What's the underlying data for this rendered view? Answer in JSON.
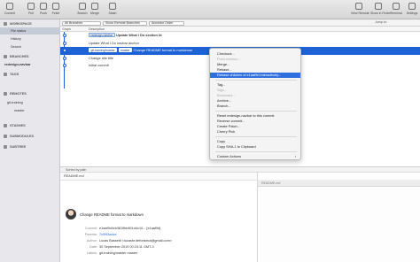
{
  "toolbar": {
    "buttons": [
      {
        "label": "Commit",
        "icon": "commit-icon"
      },
      {
        "label": "Pull",
        "icon": "pull-icon"
      },
      {
        "label": "Push",
        "icon": "push-icon"
      },
      {
        "label": "Fetch",
        "icon": "fetch-icon"
      },
      {
        "label": "Branch",
        "icon": "branch-icon"
      },
      {
        "label": "Merge",
        "icon": "merge-icon"
      },
      {
        "label": "Stash",
        "icon": "stash-icon"
      },
      {
        "label": "View Remote",
        "icon": "remote-icon"
      },
      {
        "label": "Show in Finder",
        "icon": "finder-icon"
      },
      {
        "label": "Terminal",
        "icon": "terminal-icon"
      },
      {
        "label": "Settings",
        "icon": "gear-icon"
      }
    ]
  },
  "sidebar": {
    "workspace": {
      "header": "WORKSPACE",
      "items": [
        "File status",
        "History",
        "Search"
      ]
    },
    "branches": {
      "header": "BRANCHES",
      "items": [
        "redesign-navbar"
      ]
    },
    "tags": {
      "header": "TAGS"
    },
    "remotes": {
      "header": "REMOTES",
      "items": [
        "git-training",
        "master"
      ]
    },
    "stashes": {
      "header": "STASHES"
    },
    "submodules": {
      "header": "SUBMODULES"
    },
    "subtree": {
      "header": "SUBTREE"
    }
  },
  "filters": {
    "branches": "All Branches",
    "remote": "Show Remote Branches",
    "order": "Ancestor Order",
    "jump_to": "Jump to:"
  },
  "columns": {
    "graph": "Graph",
    "description": "Description"
  },
  "commits": [
    {
      "tags": [
        "redesign-navbar"
      ],
      "message": "Update What I Do section id"
    },
    {
      "tags": [],
      "message": "Update What I Do navbar anchor"
    },
    {
      "tags": [
        "git-training/master",
        "master"
      ],
      "message": "Change README format to markdown"
    },
    {
      "tags": [],
      "message": "Change site title"
    },
    {
      "tags": [],
      "message": "Initial commit"
    }
  ],
  "context_menu": {
    "group1": [
      "Checkout...",
      "Push revision...",
      "Merge...",
      "Rebase...",
      "Rebase children of e1aaf9d interactively..."
    ],
    "group2": [
      "Tag...",
      "Sign...",
      "Bookmark...",
      "Archive...",
      "Branch..."
    ],
    "group3": [
      "Reset redesign-navbar to this commit",
      "Reverse commit...",
      "Create Patch...",
      "Cherry Pick"
    ],
    "group4": [
      "Copy",
      "Copy SHA-1 to Clipboard"
    ],
    "group5": [
      "Custom Actions"
    ]
  },
  "bottom": {
    "sort": "Sorted by path",
    "file": "README.md",
    "right_file": "README.md"
  },
  "detail": {
    "title": "Change README format to markdown",
    "commit_label": "Commit:",
    "commit": "e1aaf9d4cb3819bb801d4c10... [e1aaf9d]",
    "parents_label": "Parents:",
    "parents": "7c0f93adce",
    "author_label": "Author:",
    "author": "Lucas Bassetti <lucasbr.defonseca@gmail.com>",
    "date_label": "Date:",
    "date": "30 September 2019 00:15:11 GMT-3",
    "labels_label": "Labels:",
    "labels": "git-training/master master"
  },
  "colors": {
    "accent": "#1e63d6",
    "menu_highlight": "#2f6fde",
    "sidebar_bg": "#e8e8ec"
  }
}
